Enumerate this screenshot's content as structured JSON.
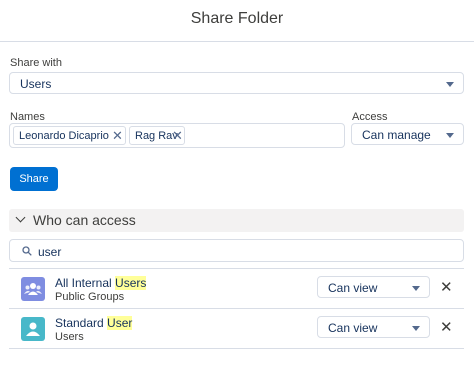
{
  "dialog": {
    "title": "Share Folder"
  },
  "share_with": {
    "label": "Share with",
    "value": "Users"
  },
  "names": {
    "label": "Names",
    "pills": [
      "Leonardo Dicaprio",
      "Rag Rav"
    ]
  },
  "access": {
    "label": "Access",
    "value": "Can manage"
  },
  "share_button": {
    "label": "Share"
  },
  "who_can_access": {
    "title": "Who can access",
    "search_value": "user",
    "entries": [
      {
        "name_before": "All Internal ",
        "name_highlight": "Users",
        "name_after": "",
        "subtitle": "Public Groups",
        "access": "Can view",
        "avatar_color": "#7f8de1"
      },
      {
        "name_before": "Standard ",
        "name_highlight": "User",
        "name_after": "",
        "subtitle": "Users",
        "access": "Can view",
        "avatar_color": "#48b8c9"
      }
    ]
  },
  "colors": {
    "brand": "#0070d2",
    "highlight": "#ffff99",
    "border": "#d8dde6"
  }
}
